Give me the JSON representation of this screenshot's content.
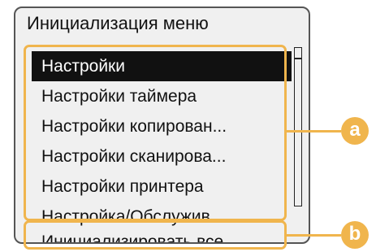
{
  "screen": {
    "title": "Инициализация меню",
    "menu_items": [
      {
        "label": "Настройки",
        "selected": true
      },
      {
        "label": "Настройки таймера",
        "selected": false
      },
      {
        "label": "Настройки копирован...",
        "selected": false
      },
      {
        "label": "Настройки сканирова...",
        "selected": false
      },
      {
        "label": "Настройки принтера",
        "selected": false
      },
      {
        "label": "Настройка/Обслужив...",
        "selected": false
      }
    ],
    "bottom_item": {
      "label": "Инициализировать все"
    }
  },
  "callouts": {
    "a": {
      "label": "a"
    },
    "b": {
      "label": "b"
    }
  },
  "colors": {
    "callout": "#f0b54d",
    "selected_bg": "#111111",
    "screen_bg": "#f0f0f0"
  }
}
